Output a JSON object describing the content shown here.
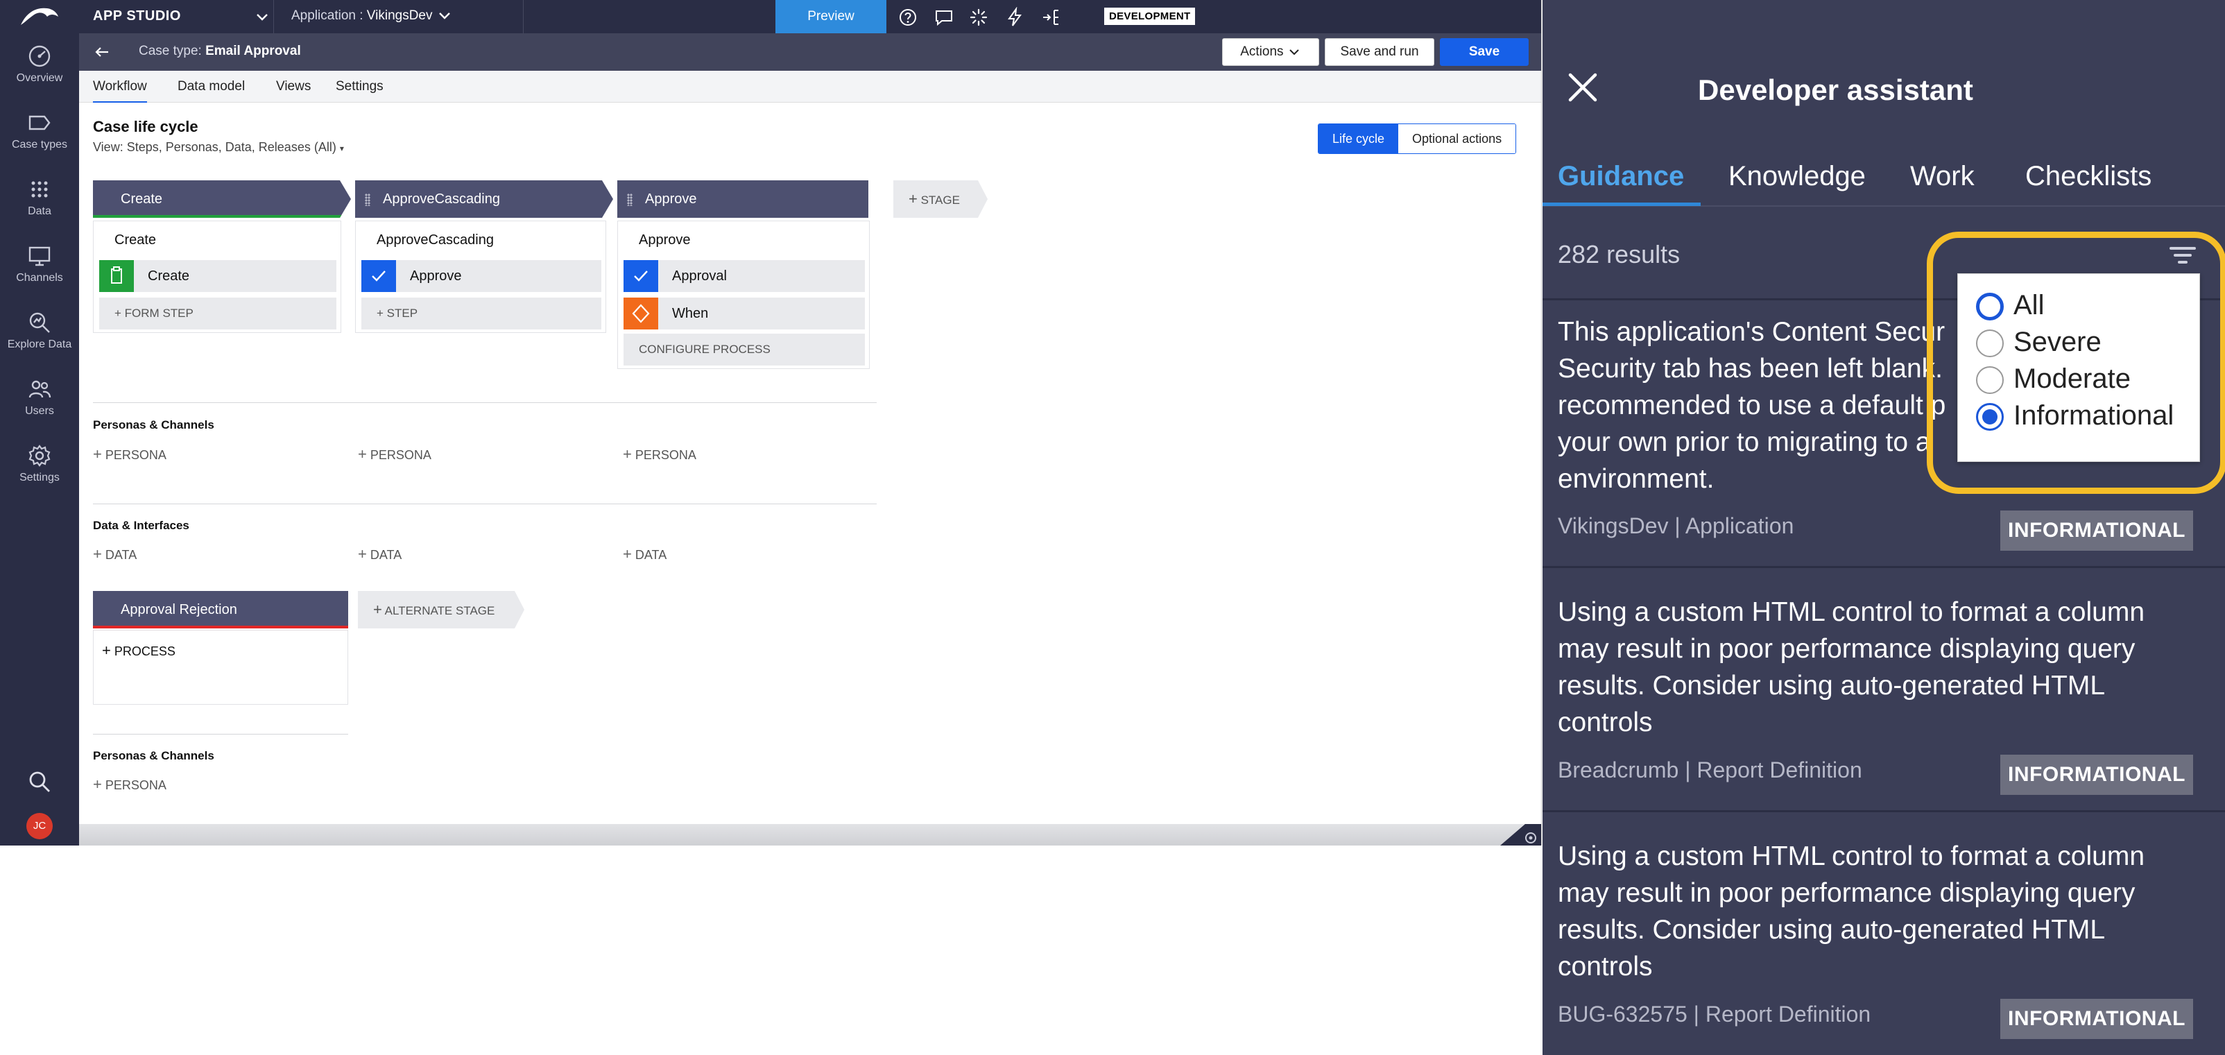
{
  "topbar": {
    "studio": "APP STUDIO",
    "application_label": "Application :",
    "application_name": "VikingsDev",
    "preview": "Preview",
    "env_badge": "DEVELOPMENT"
  },
  "leftnav": {
    "items": [
      {
        "label": "Overview",
        "icon": "dashboard-icon"
      },
      {
        "label": "Case types",
        "icon": "case-types-icon"
      },
      {
        "label": "Data",
        "icon": "grid-icon"
      },
      {
        "label": "Channels",
        "icon": "monitor-icon"
      },
      {
        "label": "Explore Data",
        "icon": "explore-icon"
      },
      {
        "label": "Users",
        "icon": "users-icon"
      },
      {
        "label": "Settings",
        "icon": "gear-icon"
      }
    ],
    "avatar_initials": "JC"
  },
  "casebar": {
    "prefix": "Case type:",
    "name": "Email Approval",
    "actions": "Actions",
    "save_and_run": "Save and run",
    "save": "Save"
  },
  "tabs": [
    "Workflow",
    "Data model",
    "Views",
    "Settings"
  ],
  "lifecycle": {
    "title": "Case life cycle",
    "view": "View: Steps, Personas, Data, Releases (All)",
    "toggle_lifecycle": "Life cycle",
    "toggle_optional": "Optional actions",
    "stages": [
      {
        "name": "Create",
        "process": "Create",
        "steps": [
          "Create"
        ],
        "add": "FORM STEP"
      },
      {
        "name": "ApproveCascading",
        "process": "ApproveCascading",
        "steps": [
          "Approve"
        ],
        "add": "STEP"
      },
      {
        "name": "Approve",
        "process": "Approve",
        "steps": [
          "Approval",
          "When"
        ],
        "add": "CONFIGURE PROCESS"
      }
    ],
    "add_stage": "STAGE",
    "personas_title": "Personas & Channels",
    "persona_add": "PERSONA",
    "data_title": "Data & Interfaces",
    "data_add": "DATA",
    "alt_stage": {
      "name": "Approval Rejection",
      "add_process": "PROCESS"
    },
    "add_alt_stage": "ALTERNATE STAGE",
    "personas2_title": "Personas & Channels",
    "persona2_add": "PERSONA"
  },
  "devpanel": {
    "title": "Developer assistant",
    "tabs": [
      "Guidance",
      "Knowledge",
      "Work",
      "Checklists"
    ],
    "results": "282 results",
    "filter_options": [
      "All",
      "Severe",
      "Moderate",
      "Informational"
    ],
    "selected_filter": "Informational",
    "cards": [
      {
        "lines": [
          "This application's Content Secur",
          "Security tab has been left blank.",
          "recommended to use a default p",
          "your own prior to migrating to a",
          "environment."
        ],
        "meta": "VikingsDev | Application",
        "badge": "INFORMATIONAL"
      },
      {
        "lines": [
          "Using a custom HTML control to format a column",
          "may result in poor performance displaying query",
          "results. Consider using auto-generated HTML",
          "controls"
        ],
        "meta": "Breadcrumb | Report Definition",
        "badge": "INFORMATIONAL"
      },
      {
        "lines": [
          "Using a custom HTML control to format a column",
          "may result in poor performance displaying query",
          "results. Consider using auto-generated HTML",
          "controls"
        ],
        "meta": "BUG-632575 | Report Definition",
        "badge": "INFORMATIONAL"
      }
    ]
  },
  "colors": {
    "nav": "#2a2d45",
    "accent": "#1760e8",
    "panel": "#3b3e57",
    "highlight": "#f5be28",
    "create_green": "#21a03c",
    "when_orange": "#f26a1b"
  }
}
